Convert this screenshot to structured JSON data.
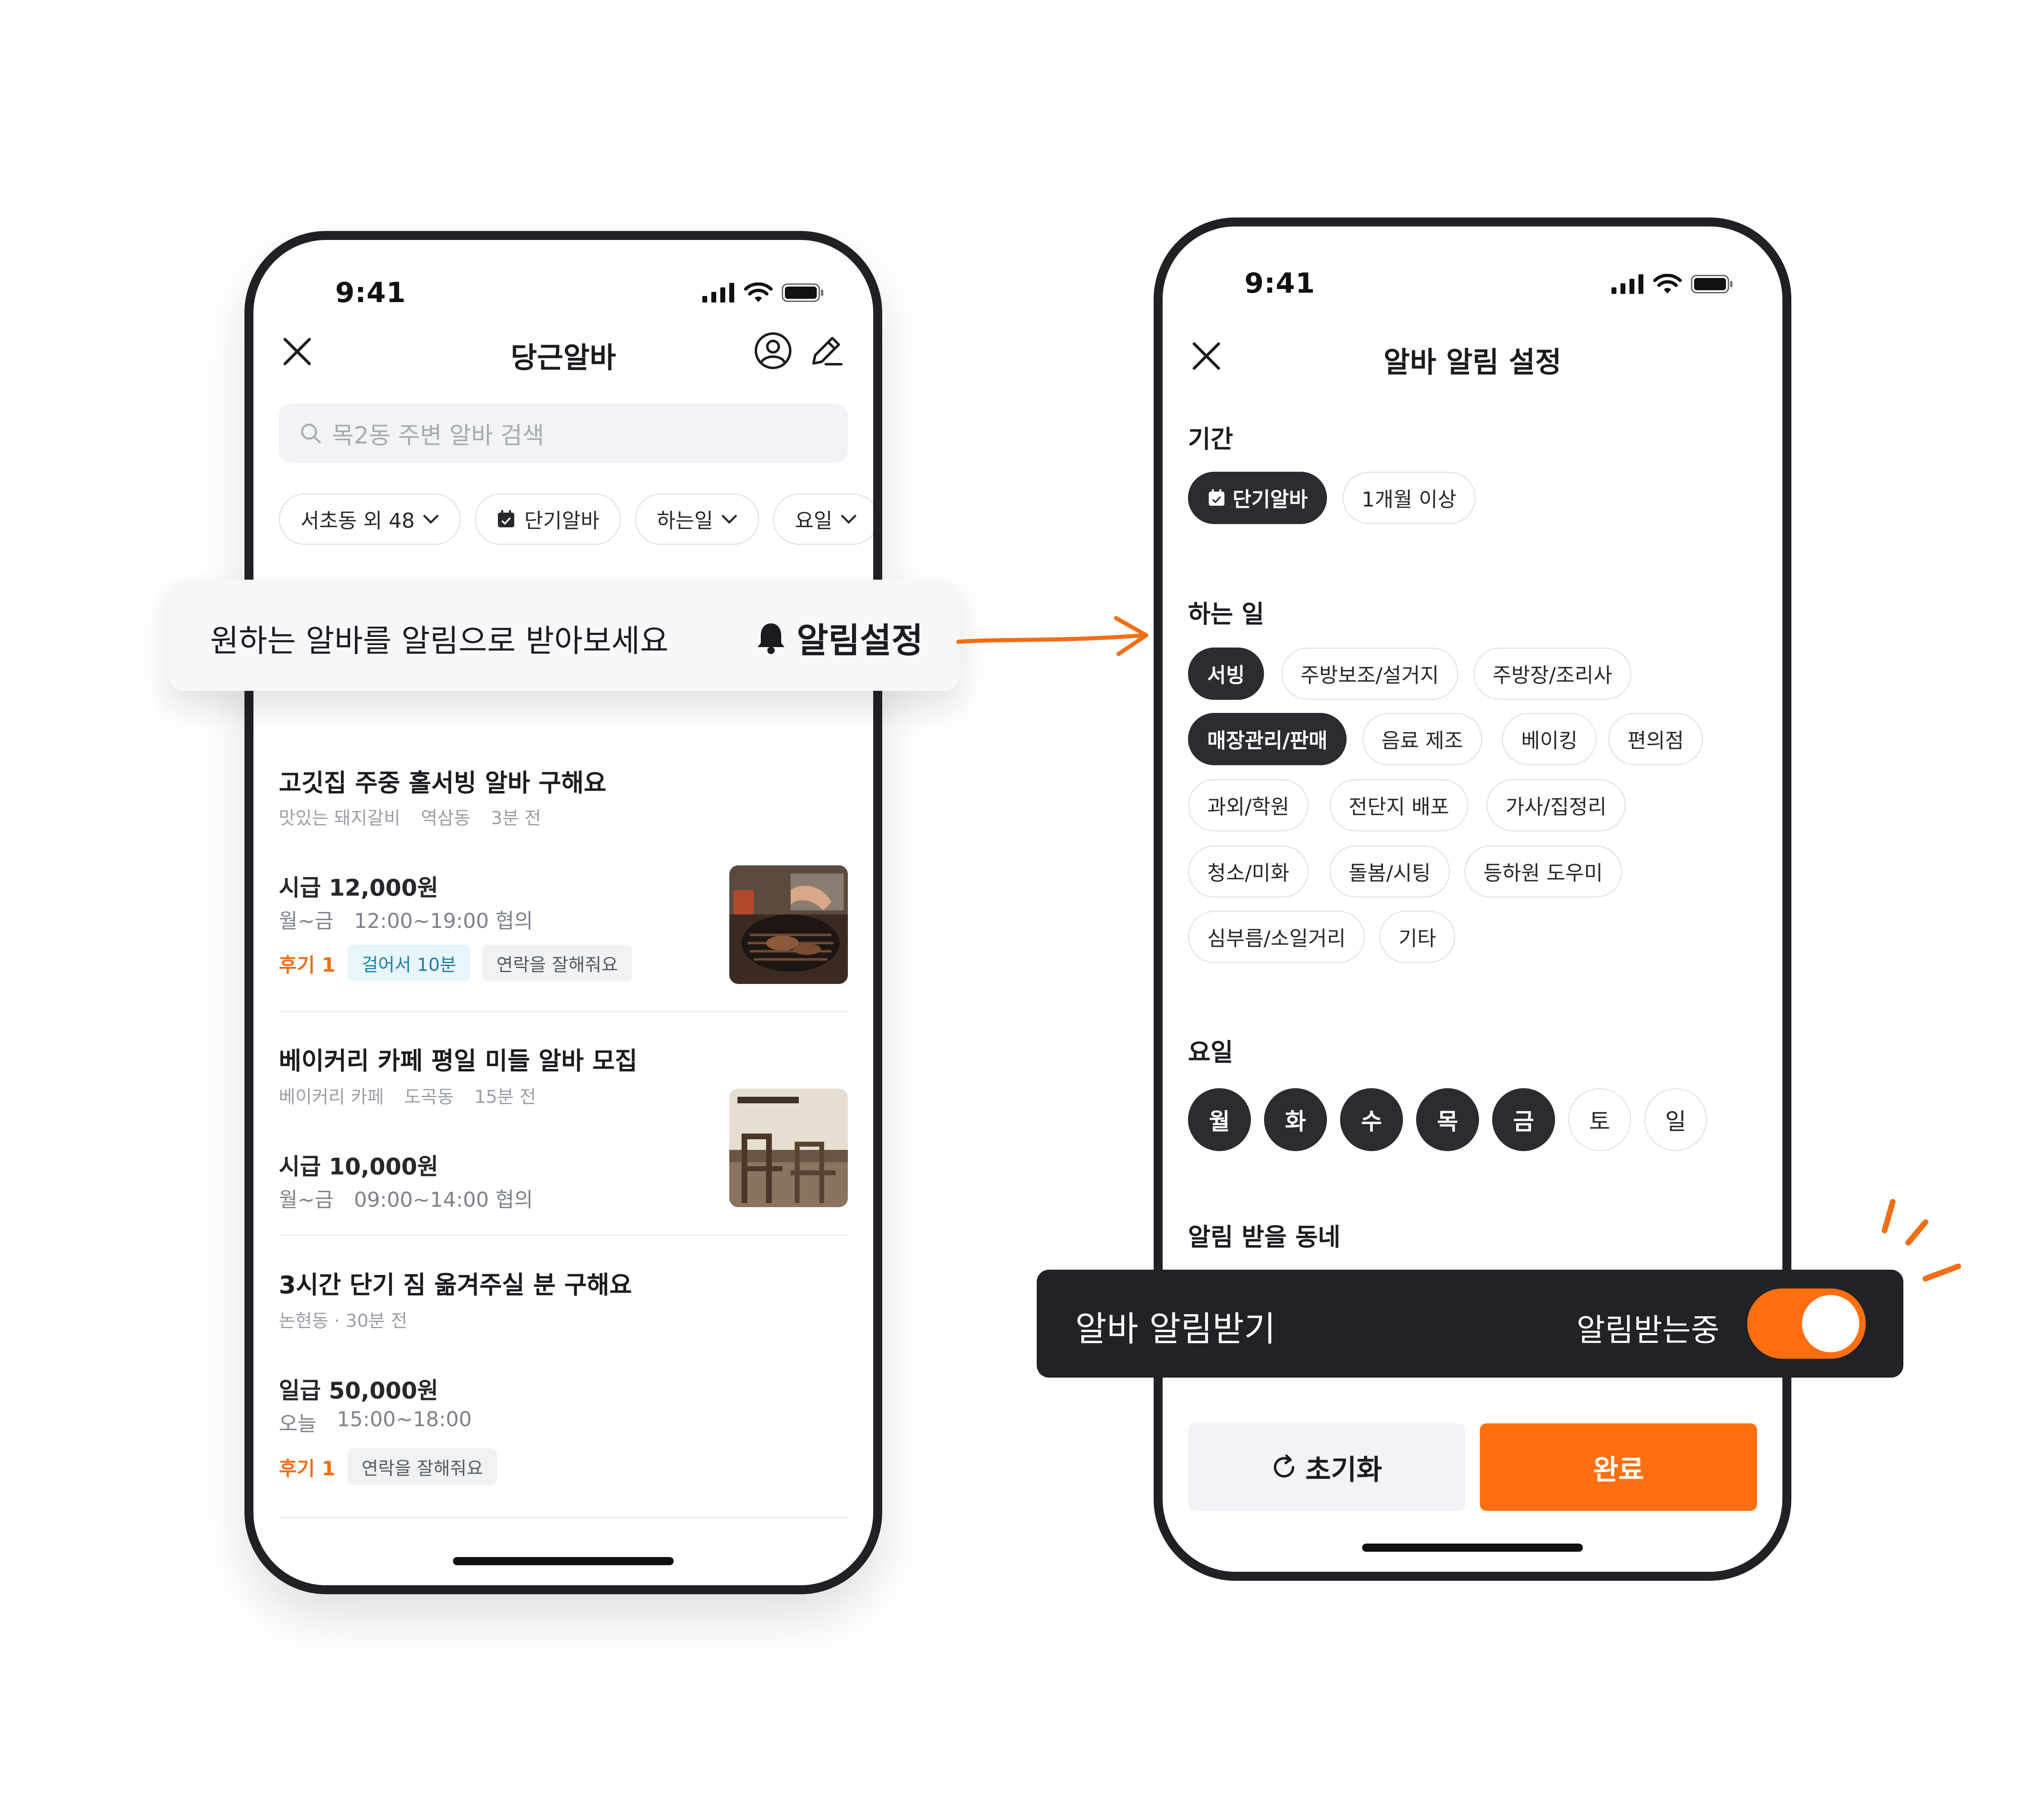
{
  "left_phone": {
    "status": {
      "time": "9:41"
    },
    "nav": {
      "title": "당근알바",
      "close_icon": "close-icon",
      "profile_icon": "profile-icon",
      "edit_icon": "edit-icon"
    },
    "search": {
      "placeholder": "목2동 주변 알바 검색"
    },
    "filters": [
      {
        "label": "서초동 외 48",
        "has_dropdown": true
      },
      {
        "label": "단기알바",
        "icon": "calendar-check-icon"
      },
      {
        "label": "하는일",
        "has_dropdown": true
      },
      {
        "label": "요일",
        "has_dropdown": true
      }
    ],
    "posts": [
      {
        "title": "고깃집 주중 홀서빙 알바 구해요",
        "meta": [
          "맛있는 돼지갈비",
          "역삼동",
          "3분 전"
        ],
        "pay": "시급 12,000원",
        "schedule": [
          "월~금",
          "12:00~19:00 협의"
        ],
        "review": "후기 1",
        "tags": [
          {
            "text": "걸어서 10분",
            "style": "blue"
          },
          {
            "text": "연락을 잘해줘요",
            "style": "gray"
          }
        ],
        "thumb": "grill-photo"
      },
      {
        "title": "베이커리 카페 평일 미들 알바 모집",
        "meta": [
          "베이커리 카페",
          "도곡동",
          "15분 전"
        ],
        "pay": "시급 10,000원",
        "schedule": [
          "월~금",
          "09:00~14:00 협의"
        ],
        "thumb": "cafe-photo"
      },
      {
        "title": "3시간 단기 짐 옮겨주실 분 구해요",
        "meta": [
          "논현동 · 30분 전"
        ],
        "pay": "일급 50,000원",
        "schedule": [
          "오늘",
          "15:00~18:00"
        ],
        "review": "후기 1",
        "tags": [
          {
            "text": "연락을 잘해줘요",
            "style": "gray"
          }
        ]
      }
    ]
  },
  "banner": {
    "text": "원하는 알바를 알림으로 받아보세요",
    "action": "알림설정",
    "icon": "bell-icon"
  },
  "right_phone": {
    "status": {
      "time": "9:41"
    },
    "nav": {
      "title": "알바 알림 설정",
      "close_icon": "close-icon"
    },
    "period": {
      "title": "기간",
      "options": [
        {
          "label": "단기알바",
          "selected": true,
          "icon": "calendar-check-icon"
        },
        {
          "label": "1개월 이상",
          "selected": false
        }
      ]
    },
    "jobs": {
      "title": "하는 일",
      "options": [
        {
          "label": "서빙",
          "selected": true
        },
        {
          "label": "주방보조/설거지",
          "selected": false
        },
        {
          "label": "주방장/조리사",
          "selected": false
        },
        {
          "label": "매장관리/판매",
          "selected": true
        },
        {
          "label": "음료 제조",
          "selected": false
        },
        {
          "label": "베이킹",
          "selected": false
        },
        {
          "label": "편의점",
          "selected": false
        },
        {
          "label": "과외/학원",
          "selected": false
        },
        {
          "label": "전단지 배포",
          "selected": false
        },
        {
          "label": "가사/집정리",
          "selected": false
        },
        {
          "label": "청소/미화",
          "selected": false
        },
        {
          "label": "돌봄/시팅",
          "selected": false
        },
        {
          "label": "등하원 도우미",
          "selected": false
        },
        {
          "label": "심부름/소일거리",
          "selected": false
        },
        {
          "label": "기타",
          "selected": false
        }
      ]
    },
    "days": {
      "title": "요일",
      "options": [
        {
          "label": "월",
          "selected": true
        },
        {
          "label": "화",
          "selected": true
        },
        {
          "label": "수",
          "selected": true
        },
        {
          "label": "목",
          "selected": true
        },
        {
          "label": "금",
          "selected": true
        },
        {
          "label": "토",
          "selected": false
        },
        {
          "label": "일",
          "selected": false
        }
      ]
    },
    "neighborhood": {
      "title": "알림 받을 동네"
    },
    "buttons": {
      "reset": "초기화",
      "reset_icon": "refresh-icon",
      "done": "완료"
    }
  },
  "toggle_bar": {
    "title": "알바 알림받기",
    "status": "알림받는중",
    "on": true
  },
  "colors": {
    "accent": "#ff6f0f",
    "dark": "#212226",
    "chip_selected": "#2a2c30"
  }
}
